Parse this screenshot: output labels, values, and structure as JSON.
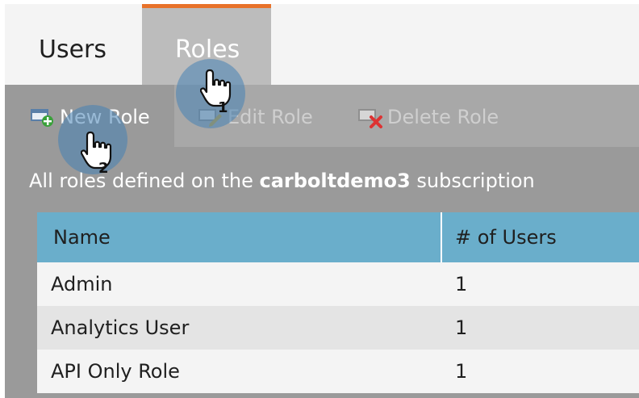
{
  "tabs": {
    "users": "Users",
    "roles": "Roles"
  },
  "toolbar": {
    "new_role": "New Role",
    "edit_role": "Edit Role",
    "delete_role": "Delete Role"
  },
  "description": {
    "prefix": "All roles defined on the ",
    "subscription": "carboltdemo3",
    "suffix": " subscription"
  },
  "table": {
    "headers": {
      "name": "Name",
      "users": "# of Users"
    },
    "rows": [
      {
        "name": "Admin",
        "users": "1"
      },
      {
        "name": "Analytics User",
        "users": "1"
      },
      {
        "name": "API Only Role",
        "users": "1"
      }
    ]
  },
  "callouts": {
    "step1": "1",
    "step2": "2"
  },
  "colors": {
    "active_tab_accent": "#e8722a",
    "table_header": "#6aaecb",
    "callout_halo": "#4682b4"
  },
  "icons": {
    "new_role": "new-role-icon",
    "edit_role": "edit-role-icon",
    "delete_role": "delete-role-icon",
    "pointer": "hand-pointer-icon"
  }
}
